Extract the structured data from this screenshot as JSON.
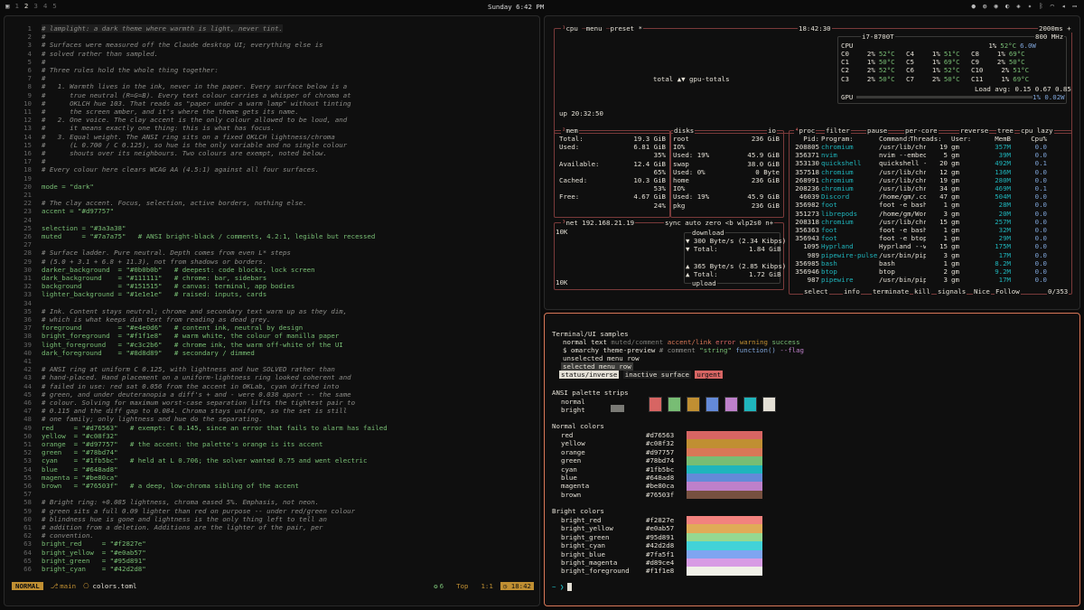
{
  "topbar": {
    "workspaces": [
      "1",
      "2",
      "3",
      "4",
      "5"
    ],
    "clock": "Sunday 6:42 PM"
  },
  "editor": {
    "lines": [
      {
        "n": "1",
        "t": "# lamplight: a dark theme where warmth is light, never tint.",
        "cls": "c"
      },
      {
        "n": "2",
        "t": "#",
        "cls": "c"
      },
      {
        "n": "3",
        "t": "# Surfaces were measured off the Claude desktop UI; everything else is",
        "cls": "c"
      },
      {
        "n": "4",
        "t": "# solved rather than sampled.",
        "cls": "c"
      },
      {
        "n": "5",
        "t": "#",
        "cls": "c"
      },
      {
        "n": "6",
        "t": "# Three rules hold the whole thing together:",
        "cls": "c"
      },
      {
        "n": "7",
        "t": "#",
        "cls": "c"
      },
      {
        "n": "8",
        "t": "#   1. Warmth lives in the ink, never in the paper. Every surface below is a",
        "cls": "c"
      },
      {
        "n": "9",
        "t": "#      true neutral (R=G=B). Every text colour carries a whisper of chroma at",
        "cls": "c"
      },
      {
        "n": "10",
        "t": "#      OKLCH hue 103. That reads as \"paper under a warm lamp\" without tinting",
        "cls": "c"
      },
      {
        "n": "11",
        "t": "#      the screen amber, and it's where the theme gets its name.",
        "cls": "c"
      },
      {
        "n": "12",
        "t": "#   2. One voice. The clay accent is the only colour allowed to be loud, and",
        "cls": "c"
      },
      {
        "n": "13",
        "t": "#      it means exactly one thing: this is what has focus.",
        "cls": "c"
      },
      {
        "n": "14",
        "t": "#   3. Equal weight. The ANSI ring sits on a fixed OKLCH lightness/chroma",
        "cls": "c"
      },
      {
        "n": "15",
        "t": "#      (L 0.700 / C 0.125), so hue is the only variable and no single colour",
        "cls": "c"
      },
      {
        "n": "16",
        "t": "#      shouts over its neighbours. Two colours are exempt, noted below.",
        "cls": "c"
      },
      {
        "n": "17",
        "t": "#",
        "cls": "c"
      },
      {
        "n": "18",
        "t": "# Every colour here clears WCAG AA (4.5:1) against all four surfaces.",
        "cls": "c"
      },
      {
        "n": "19",
        "t": "",
        "cls": ""
      },
      {
        "n": "20",
        "t": "mode = \"dark\"",
        "cls": "s"
      },
      {
        "n": "21",
        "t": "",
        "cls": ""
      },
      {
        "n": "22",
        "t": "# The clay accent. Focus, selection, active borders, nothing else.",
        "cls": "c"
      },
      {
        "n": "23",
        "t": "accent = \"#d97757\"",
        "cls": "s"
      },
      {
        "n": "24",
        "t": "",
        "cls": ""
      },
      {
        "n": "25",
        "t": "selection = \"#3a3a38\"",
        "cls": "s"
      },
      {
        "n": "26",
        "t": "muted     = \"#7a7a75\"   # ANSI bright-black / comments, 4.2:1, legible but recessed",
        "cls": "s"
      },
      {
        "n": "27",
        "t": "",
        "cls": ""
      },
      {
        "n": "28",
        "t": "# Surface ladder. Pure neutral. Depth comes from even L* steps",
        "cls": "c"
      },
      {
        "n": "29",
        "t": "# (5.0 + 3.1 + 6.8 + 11.3), not from shadows or borders.",
        "cls": "c"
      },
      {
        "n": "30",
        "t": "darker_background  = \"#0b0b0b\"   # deepest: code blocks, lock screen",
        "cls": "s"
      },
      {
        "n": "31",
        "t": "dark_background    = \"#111111\"   # chrome: bar, sidebars",
        "cls": "s"
      },
      {
        "n": "32",
        "t": "background         = \"#151515\"   # canvas: terminal, app bodies",
        "cls": "s"
      },
      {
        "n": "33",
        "t": "lighter_background = \"#1e1e1e\"   # raised: inputs, cards",
        "cls": "s"
      },
      {
        "n": "34",
        "t": "",
        "cls": ""
      },
      {
        "n": "35",
        "t": "# Ink. Content stays neutral; chrome and secondary text warm up as they dim,",
        "cls": "c"
      },
      {
        "n": "36",
        "t": "# which is what keeps dim text from reading as dead grey.",
        "cls": "c"
      },
      {
        "n": "37",
        "t": "foreground         = \"#e4e0d6\"   # content ink, neutral by design",
        "cls": "s"
      },
      {
        "n": "38",
        "t": "bright_foreground  = \"#f1f1e8\"   # warm white, the colour of manilla paper",
        "cls": "s"
      },
      {
        "n": "39",
        "t": "light_foreground   = \"#c3c2b6\"   # chrome ink, the warm off-white of the UI",
        "cls": "s"
      },
      {
        "n": "40",
        "t": "dark_foreground    = \"#8d8d89\"   # secondary / dimmed",
        "cls": "s"
      },
      {
        "n": "41",
        "t": "",
        "cls": ""
      },
      {
        "n": "42",
        "t": "# ANSI ring at uniform C 0.125, with lightness and hue SOLVED rather than",
        "cls": "c"
      },
      {
        "n": "43",
        "t": "# hand-placed. Hand placement on a uniform-lightness ring looked coherent and",
        "cls": "c"
      },
      {
        "n": "44",
        "t": "# failed in use: red sat 0.056 from the accent in OKLab, cyan drifted into",
        "cls": "c"
      },
      {
        "n": "45",
        "t": "# green, and under deuteranopia a diff's + and - were 0.038 apart -- the same",
        "cls": "c"
      },
      {
        "n": "46",
        "t": "# colour. Solving for maximum worst-case separation lifts the tightest pair to",
        "cls": "c"
      },
      {
        "n": "47",
        "t": "# 0.115 and the diff gap to 0.084. Chroma stays uniform, so the set is still",
        "cls": "c"
      },
      {
        "n": "48",
        "t": "# one family; only lightness and hue do the separating.",
        "cls": "c"
      },
      {
        "n": "49",
        "t": "red     = \"#d76563\"   # exempt: C 0.145, since an error that fails to alarm has failed",
        "cls": "s"
      },
      {
        "n": "50",
        "t": "yellow  = \"#c08f32\"",
        "cls": "s"
      },
      {
        "n": "51",
        "t": "orange  = \"#d97757\"   # the accent: the palette's orange is its accent",
        "cls": "s"
      },
      {
        "n": "52",
        "t": "green   = \"#78bd74\"",
        "cls": "s"
      },
      {
        "n": "53",
        "t": "cyan    = \"#1fb5bc\"   # held at L 0.706; the solver wanted 0.75 and went electric",
        "cls": "s"
      },
      {
        "n": "54",
        "t": "blue    = \"#648ad8\"",
        "cls": "s"
      },
      {
        "n": "55",
        "t": "magenta = \"#be80ca\"",
        "cls": "s"
      },
      {
        "n": "56",
        "t": "brown   = \"#76503f\"   # a deep, low-chroma sibling of the accent",
        "cls": "s"
      },
      {
        "n": "57",
        "t": "",
        "cls": ""
      },
      {
        "n": "58",
        "t": "# Bright ring: +0.085 lightness, chroma eased 5%. Emphasis, not neon.",
        "cls": "c"
      },
      {
        "n": "59",
        "t": "# green sits a full 0.09 lighter than red on purpose -- under red/green colour",
        "cls": "c"
      },
      {
        "n": "60",
        "t": "# blindness hue is gone and lightness is the only thing left to tell an",
        "cls": "c"
      },
      {
        "n": "61",
        "t": "# addition from a deletion. Additions are the lighter of the pair, per",
        "cls": "c"
      },
      {
        "n": "62",
        "t": "# convention.",
        "cls": "c"
      },
      {
        "n": "63",
        "t": "bright_red     = \"#f2827e\"",
        "cls": "s"
      },
      {
        "n": "64",
        "t": "bright_yellow  = \"#e0ab57\"",
        "cls": "s"
      },
      {
        "n": "65",
        "t": "bright_green   = \"#95d891\"",
        "cls": "s"
      },
      {
        "n": "66",
        "t": "bright_cyan    = \"#42d2d8\"",
        "cls": "s"
      }
    ],
    "status": {
      "mode": "NORMAL",
      "branch": "main",
      "file": "colors.toml",
      "diag": "6",
      "pos": "Top",
      "cursor": "1:1",
      "time": "18:42"
    }
  },
  "btop": {
    "cpu_title": "cpu",
    "menu": "menu",
    "preset": "preset *",
    "time": "18:42:30",
    "interval": "2000ms +",
    "cpu_model": "i7-8700T",
    "freq": "800 MHz",
    "uptime": "up 20:32:50",
    "graph_label": "total ▲▼ gpu-totals",
    "cores": [
      [
        "CPU",
        "1%",
        "52°C",
        "6.0W"
      ],
      [
        "C0",
        "2%",
        "52°C"
      ],
      [
        "C4",
        "1%",
        "51°C"
      ],
      [
        "C8",
        "1%",
        "69°C"
      ],
      [
        "C1",
        "1%",
        "50°C"
      ],
      [
        "C5",
        "1%",
        "69°C"
      ],
      [
        "C9",
        "2%",
        "50°C"
      ],
      [
        "C2",
        "2%",
        "52°C"
      ],
      [
        "C6",
        "1%",
        "52°C"
      ],
      [
        "C10",
        "2%",
        "51°C"
      ],
      [
        "C3",
        "2%",
        "50°C"
      ],
      [
        "C7",
        "2%",
        "50°C"
      ],
      [
        "C11",
        "1%",
        "69°C"
      ]
    ],
    "load": "Load avg: 0.15 0.67 0.85",
    "gpu": "GPU",
    "gpu_pct": "1%",
    "gpu_w": "0.02W",
    "mem": [
      [
        "Total:",
        "19.3 GiB"
      ],
      [
        "Used:",
        "6.81 GiB"
      ],
      [
        "",
        "35%"
      ],
      [
        "Available:",
        "12.4 GiB"
      ],
      [
        "",
        "65%"
      ],
      [
        "Cached:",
        "10.3 GiB"
      ],
      [
        "",
        "53%"
      ],
      [
        "Free:",
        "4.67 GiB"
      ],
      [
        "",
        "24%"
      ]
    ],
    "disks": [
      [
        "root",
        "236 GiB"
      ],
      [
        "IO%",
        ""
      ],
      [
        "Used: 19%",
        "45.9 GiB"
      ],
      [
        "swap",
        "38.0 GiB"
      ],
      [
        "Used:  0%",
        "0 Byte"
      ],
      [
        "home",
        "236 GiB"
      ],
      [
        "IO%",
        ""
      ],
      [
        "Used: 19%",
        "45.9 GiB"
      ],
      [
        "pkg",
        "236 GiB"
      ]
    ],
    "net": {
      "ip": "192.168.21.19",
      "iface": "wlp2s0",
      "scale": "10K",
      "down": "300 Byte/s (2.34 Kibps)",
      "dtotal": "1.84 GiB",
      "up": "365 Byte/s (2.85 Kibps)",
      "utotal": "1.72 GiB",
      "labels": [
        "download",
        "upload",
        "Total:"
      ]
    },
    "proc_header": [
      "Pid:",
      "Program:",
      "Command:",
      "Threads:",
      "User:",
      "MemB",
      "Cpu%"
    ],
    "procs": [
      [
        "208805",
        "chromium",
        "/usr/lib/chr",
        "19",
        "gm",
        "357M",
        "0.0"
      ],
      [
        "356371",
        "nvim",
        "nvim --embed",
        "5",
        "gm",
        "39M",
        "0.0"
      ],
      [
        "353130",
        "quickshell",
        "quickshell -",
        "20",
        "gm",
        "492M",
        "0.1"
      ],
      [
        "357518",
        "chromium",
        "/usr/lib/chr",
        "12",
        "gm",
        "136M",
        "0.0"
      ],
      [
        "268991",
        "chromium",
        "/usr/lib/chr",
        "19",
        "gm",
        "280M",
        "0.0"
      ],
      [
        "208236",
        "chromium",
        "/usr/lib/chr",
        "34",
        "gm",
        "469M",
        "0.1"
      ],
      [
        "46039",
        "Discord",
        "/home/gm/.co",
        "47",
        "gm",
        "504M",
        "0.0"
      ],
      [
        "356982",
        "foot",
        "foot -e bash",
        "1",
        "gm",
        "28M",
        "0.0"
      ],
      [
        "351273",
        "librepods",
        "/home/gm/Wor",
        "3",
        "gm",
        "20M",
        "0.0"
      ],
      [
        "208318",
        "chromium",
        "/usr/lib/chr",
        "15",
        "gm",
        "257M",
        "0.0"
      ],
      [
        "356363",
        "foot",
        "foot -e bash",
        "1",
        "gm",
        "32M",
        "0.0"
      ],
      [
        "356943",
        "foot",
        "foot -e btop",
        "1",
        "gm",
        "29M",
        "0.0"
      ],
      [
        "1095",
        "Hyprland",
        "Hyprland --w",
        "15",
        "gm",
        "175M",
        "0.0"
      ],
      [
        "989",
        "pipewire-pulse",
        "/usr/bin/pip",
        "3",
        "gm",
        "17M",
        "0.0"
      ],
      [
        "356985",
        "bash",
        "bash",
        "1",
        "gm",
        "8.2M",
        "0.0"
      ],
      [
        "356946",
        "btop",
        "btop",
        "2",
        "gm",
        "9.2M",
        "0.0"
      ],
      [
        "987",
        "pipewire",
        "/usr/bin/pip",
        "3",
        "gm",
        "17M",
        "0.0"
      ]
    ],
    "proc_menu": [
      "filter",
      "pause",
      "per-core",
      "reverse",
      "tree",
      "cpu lazy"
    ],
    "proc_foot": [
      "select",
      "info",
      "terminate",
      "kill",
      "signals",
      "Nice",
      "Follow",
      "0/353"
    ]
  },
  "terminal": {
    "title": "Terminal/UI samples",
    "samples": [
      "normal text",
      "muted/comment",
      "accent/link",
      "error",
      "warning",
      "success"
    ],
    "prompt_line": "$ omarchy theme-preview",
    "comment": "# comment",
    "string": "\"string\"",
    "func": "function()",
    "flag": "--flag",
    "unselected": "unselected menu row",
    "selected": "selected menu row",
    "status_inverse": "status/inverse",
    "inactive": "inactive surface",
    "urgent": "urgent",
    "ansi_title": "ANSI palette strips",
    "ansi_rows": [
      "normal",
      "bright"
    ],
    "normal_title": "Normal colors",
    "normal": [
      [
        "red",
        "#d76563"
      ],
      [
        "yellow",
        "#c08f32"
      ],
      [
        "orange",
        "#d97757"
      ],
      [
        "green",
        "#78bd74"
      ],
      [
        "cyan",
        "#1fb5bc"
      ],
      [
        "blue",
        "#648ad8"
      ],
      [
        "magenta",
        "#be80ca"
      ],
      [
        "brown",
        "#76503f"
      ]
    ],
    "bright_title": "Bright colors",
    "bright": [
      [
        "bright_red",
        "#f2827e"
      ],
      [
        "bright_yellow",
        "#e0ab57"
      ],
      [
        "bright_green",
        "#95d891"
      ],
      [
        "bright_cyan",
        "#42d2d8"
      ],
      [
        "bright_blue",
        "#7fa5f1"
      ],
      [
        "bright_magenta",
        "#d89ce4"
      ],
      [
        "bright_foreground",
        "#f1f1e8"
      ]
    ],
    "prompt": "~ ❯",
    "normal_strip": [
      "#151515",
      "#d76563",
      "#78bd74",
      "#c08f32",
      "#648ad8",
      "#be80ca",
      "#1fb5bc",
      "#e4e0d6"
    ],
    "bright_strip": [
      "#7a7a75",
      "#f2827e",
      "#95d891",
      "#e0ab57",
      "#7fa5f1",
      "#d89ce4",
      "#42d2d8",
      "#f1f1e8"
    ]
  }
}
